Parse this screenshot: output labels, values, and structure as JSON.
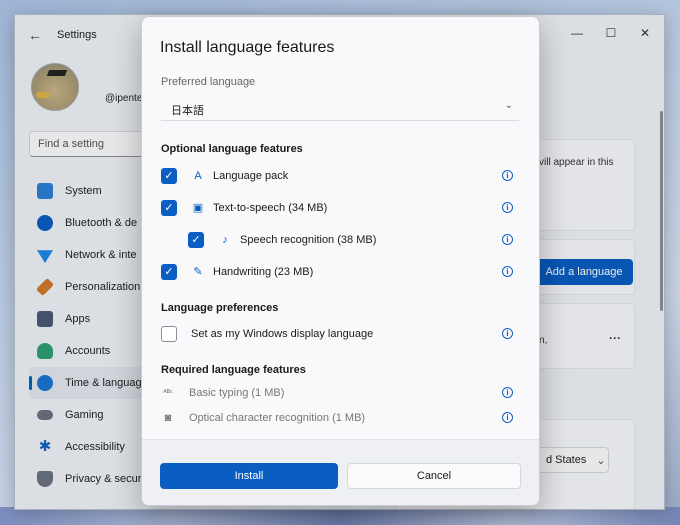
{
  "settings": {
    "app_title": "Settings",
    "username": "@ipente",
    "search_placeholder": "Find a setting",
    "nav": [
      {
        "label": "System",
        "icon": "system-icon",
        "color": "#2b7fd4"
      },
      {
        "label": "Bluetooth & de",
        "icon": "bluetooth-icon",
        "color": "#0a5ec2"
      },
      {
        "label": "Network & inte",
        "icon": "wifi-icon",
        "color": "#1e88e5"
      },
      {
        "label": "Personalization",
        "icon": "brush-icon",
        "color": "#d17a2a"
      },
      {
        "label": "Apps",
        "icon": "apps-icon",
        "color": "#4a5a78"
      },
      {
        "label": "Accounts",
        "icon": "person-icon",
        "color": "#2f9e72"
      },
      {
        "label": "Time & languag",
        "icon": "globe-clock-icon",
        "color": "#1976d2",
        "active": true
      },
      {
        "label": "Gaming",
        "icon": "gamepad-icon",
        "color": "#6b7280"
      },
      {
        "label": "Accessibility",
        "icon": "accessibility-icon",
        "color": "#1565c0"
      },
      {
        "label": "Privacy & secur",
        "icon": "shield-icon",
        "color": "#6b7280"
      }
    ],
    "right_text_1": "vill appear in this",
    "right_text_2": "n,",
    "add_language_label": "Add a language",
    "more_dots": "···",
    "region_value": "d States",
    "region_chevron": "⌄"
  },
  "dialog": {
    "title": "Install language features",
    "preferred_language_label": "Preferred language",
    "preferred_language_value": "日本語",
    "optional_heading": "Optional language features",
    "optional": [
      {
        "label": "Language pack",
        "icon": "language-pack-icon",
        "checked": true,
        "indent": false
      },
      {
        "label": "Text-to-speech (34 MB)",
        "icon": "speech-icon",
        "checked": true,
        "indent": false
      },
      {
        "label": "Speech recognition (38 MB)",
        "icon": "microphone-icon",
        "checked": true,
        "indent": true
      },
      {
        "label": "Handwriting (23 MB)",
        "icon": "handwriting-icon",
        "checked": true,
        "indent": false
      }
    ],
    "preferences_heading": "Language preferences",
    "display_language_label": "Set as my Windows display language",
    "display_language_checked": false,
    "required_heading": "Required language features",
    "required": [
      {
        "label": "Basic typing (1 MB)",
        "icon": "typing-icon"
      },
      {
        "label": "Optical character recognition (1 MB)",
        "icon": "camera-ocr-icon"
      }
    ],
    "install_label": "Install",
    "cancel_label": "Cancel",
    "accent_color": "#0a5ec2"
  }
}
